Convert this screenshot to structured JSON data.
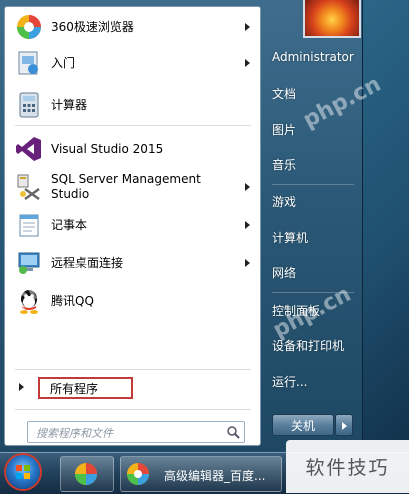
{
  "left_pane": {
    "items": [
      {
        "label": "360极速浏览器",
        "has_arrow": true,
        "icon": "360-browser-icon"
      },
      {
        "label": "入门",
        "has_arrow": true,
        "icon": "getting-started-icon"
      },
      {
        "label": "计算器",
        "has_arrow": false,
        "icon": "calculator-icon"
      },
      {
        "label": "Visual Studio 2015",
        "has_arrow": false,
        "icon": "visual-studio-icon"
      },
      {
        "label": "SQL Server Management\nStudio",
        "has_arrow": true,
        "icon": "sql-server-icon"
      },
      {
        "label": "记事本",
        "has_arrow": true,
        "icon": "notepad-icon"
      },
      {
        "label": "远程桌面连接",
        "has_arrow": true,
        "icon": "remote-desktop-icon"
      },
      {
        "label": "腾讯QQ",
        "has_arrow": false,
        "icon": "qq-icon"
      }
    ],
    "all_programs": "所有程序",
    "search_placeholder": "搜索程序和文件"
  },
  "right_pane": {
    "user": "Administrator",
    "items": [
      "文档",
      "图片",
      "音乐",
      "游戏",
      "计算机",
      "网络",
      "控制面板",
      "设备和打印机",
      "运行..."
    ],
    "shutdown": "关机"
  },
  "taskbar": {
    "window_title": "高级编辑器_百度..."
  },
  "watermark": {
    "site": "php.cn",
    "badge": "软件技巧"
  },
  "colors": {
    "highlight_border": "#c23a3a",
    "menu_blue": "#2a5876"
  }
}
